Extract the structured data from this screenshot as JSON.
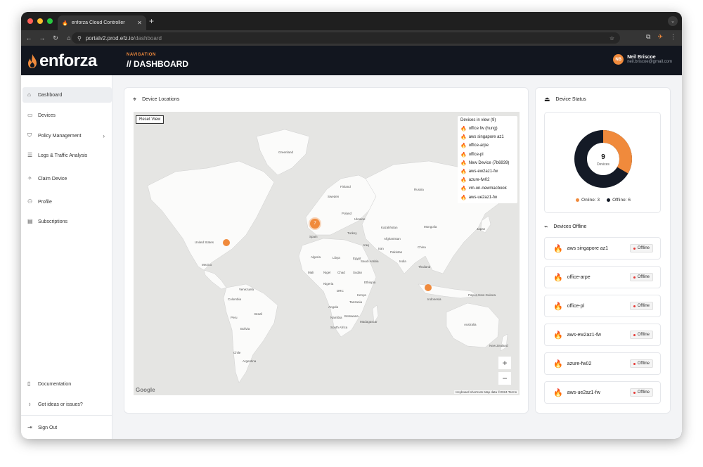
{
  "browser": {
    "tab_title": "enforza Cloud Controller",
    "new_tab": "+",
    "url_host": "portalv2.prod.efz.io",
    "url_path": "/dashboard"
  },
  "header": {
    "logo_text": "enforza",
    "nav_label": "NAVIGATION",
    "page_title": "// DASHBOARD",
    "user_initials": "NB",
    "user_name": "Neil Briscoe",
    "user_email": "neil.briscoe@gmail.com"
  },
  "sidebar": {
    "items": [
      {
        "label": "Dashboard",
        "icon": "home-icon"
      },
      {
        "label": "Devices",
        "icon": "server-icon"
      },
      {
        "label": "Policy Management",
        "icon": "shield-icon"
      },
      {
        "label": "Logs & Traffic Analysis",
        "icon": "list-icon"
      },
      {
        "label": "Claim Device",
        "icon": "sparkle-icon"
      },
      {
        "label": "Profile",
        "icon": "user-icon"
      },
      {
        "label": "Subscriptions",
        "icon": "card-icon"
      }
    ],
    "bottom": [
      {
        "label": "Documentation",
        "icon": "book-icon"
      },
      {
        "label": "Got ideas or issues?",
        "icon": "bulb-icon"
      },
      {
        "label": "Sign Out",
        "icon": "logout-icon"
      }
    ]
  },
  "locations": {
    "title": "Device Locations",
    "reset_label": "Reset View",
    "devices_in_view_title": "Devices in view (9)",
    "devices": [
      "office fw (hung)",
      "aws singapore az1",
      "office-arpe",
      "office-pl",
      "New Device (7b6939)",
      "aws-ew2az1-fw",
      "azure-fw02",
      "vm-on-newmacbook",
      "aws-ue2az1-fw"
    ],
    "cluster_count": "7",
    "zoom_in": "+",
    "zoom_out": "−",
    "google": "Google",
    "attribution": "Keyboard shortcuts    Map data ©2024    Terms",
    "map_labels": [
      "Greenland",
      "Finland",
      "Sweden",
      "Russia",
      "Kazakhstan",
      "Mongolia",
      "China",
      "United States",
      "Mexico",
      "Venezuela",
      "Colombia",
      "Brazil",
      "Peru",
      "Bolivia",
      "Chile",
      "Argentina",
      "Algeria",
      "Libya",
      "Egypt",
      "Mali",
      "Niger",
      "Chad",
      "Sudan",
      "Nigeria",
      "Ethiopia",
      "DRC",
      "Kenya",
      "Tanzania",
      "Angola",
      "Namibia",
      "Botswana",
      "South Africa",
      "Madagascar",
      "Saudi Arabia",
      "Iran",
      "Turkey",
      "Ukraine",
      "Poland",
      "Iraq",
      "Pakistan",
      "India",
      "Thailand",
      "Indonesia",
      "Papua New Guinea",
      "Australia",
      "New Zealand",
      "Afghanistan",
      "Japan",
      "Spain"
    ]
  },
  "status": {
    "title": "Device Status",
    "total": "9",
    "total_label": "Devices",
    "online_label": "Online: 3",
    "offline_label": "Offline: 6",
    "online_color": "#f08a3c",
    "offline_color": "#141a26",
    "online_count": 3,
    "offline_count": 6
  },
  "offline": {
    "title": "Devices Offline",
    "badge_label": "Offline",
    "items": [
      "aws singapore az1",
      "office-arpe",
      "office-pl",
      "aws-ew2az1-fw",
      "azure-fw02",
      "aws-ue2az1-fw"
    ]
  },
  "colors": {
    "accent": "#f08a3c",
    "header_bg": "#12161f"
  }
}
